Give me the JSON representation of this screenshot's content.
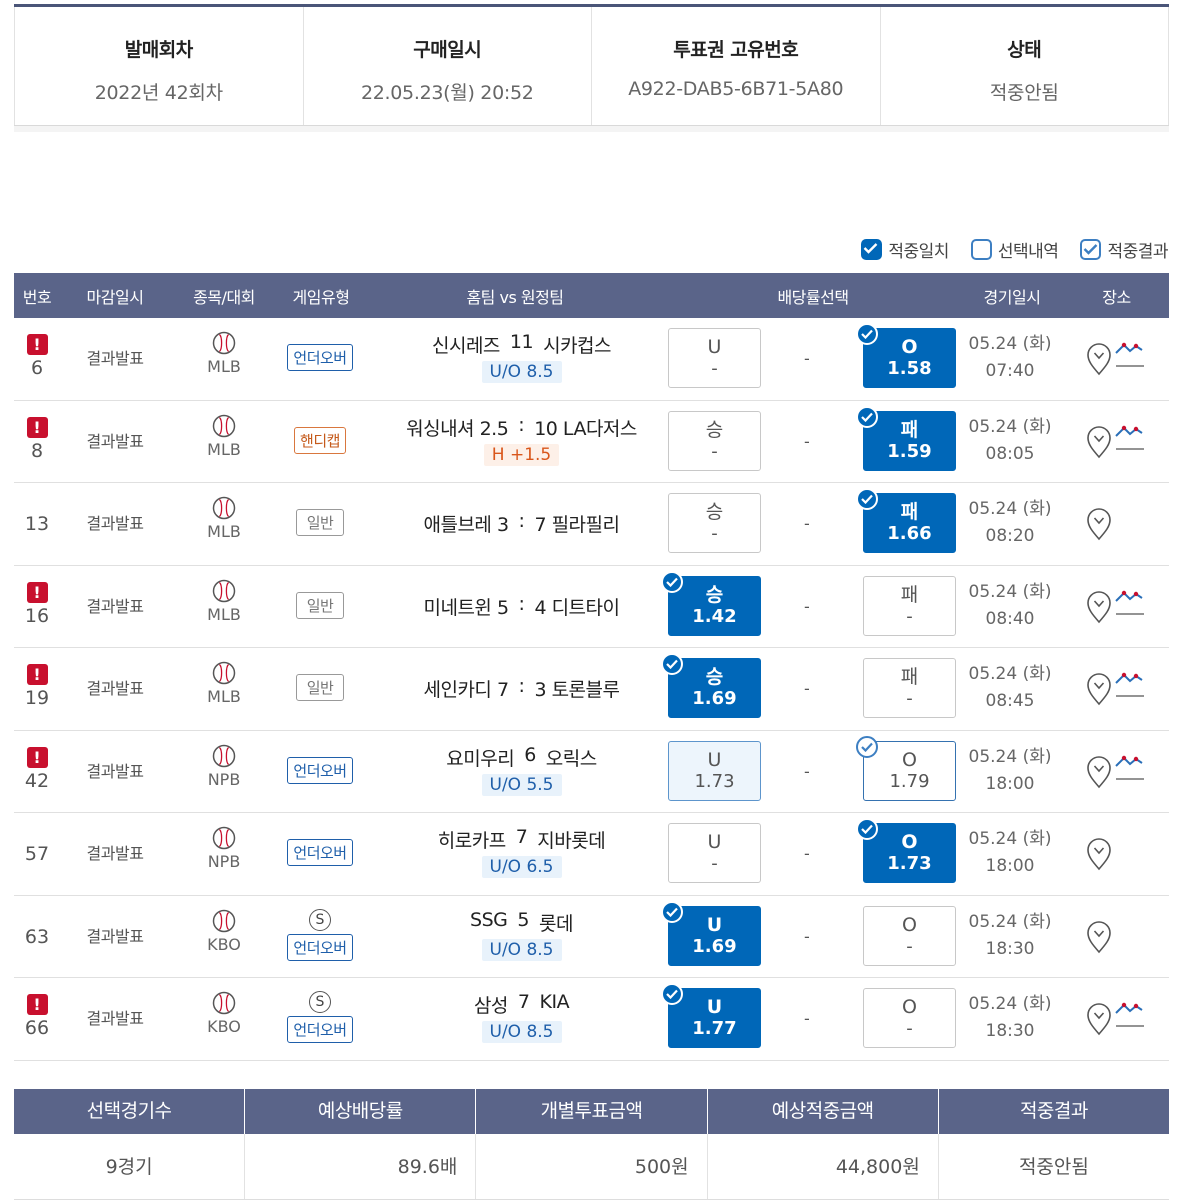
{
  "summary": {
    "round_label": "발매회차",
    "round_value": "2022년 42회차",
    "purchase_label": "구매일시",
    "purchase_value": "22.05.23(월) 20:52",
    "ticket_label": "투표권 고유번호",
    "ticket_value": "A922-DAB5-6B71-5A80",
    "status_label": "상태",
    "status_value": "적중안됨"
  },
  "legend": {
    "hit_match": "적중일치",
    "selection": "선택내역",
    "hit_result": "적중결과"
  },
  "table_headers": {
    "no": "번호",
    "close": "마감일시",
    "sport": "종목/대회",
    "type": "게임유형",
    "teams": "홈팀 vs 원정팀",
    "odds": "배당률선택",
    "date": "경기일시",
    "venue": "장소"
  },
  "rows": [
    {
      "no": "6",
      "warn": "!",
      "close": "결과발표",
      "league": "MLB",
      "type": "언더오버",
      "home": "신시레즈",
      "score": "11",
      "away": "시카컵스",
      "sub": "U/O 8.5",
      "o1_label": "U",
      "o1_val": "-",
      "mid": "-",
      "o3_label": "O",
      "o3_val": "1.58",
      "date": "05.24 (화)",
      "time": "07:40"
    },
    {
      "no": "8",
      "warn": "!",
      "close": "결과발표",
      "league": "MLB",
      "type": "핸디캡",
      "home": "워싱내셔 2.5",
      "score": ":",
      "away": "10 LA다저스",
      "sub": "H +1.5",
      "o1_label": "승",
      "o1_val": "-",
      "mid": "-",
      "o3_label": "패",
      "o3_val": "1.59",
      "date": "05.24 (화)",
      "time": "08:05"
    },
    {
      "no": "13",
      "close": "결과발표",
      "league": "MLB",
      "type": "일반",
      "home": "애틀브레 3",
      "score": ":",
      "away": "7 필라필리",
      "o1_label": "승",
      "o1_val": "-",
      "mid": "-",
      "o3_label": "패",
      "o3_val": "1.66",
      "date": "05.24 (화)",
      "time": "08:20"
    },
    {
      "no": "16",
      "warn": "!",
      "close": "결과발표",
      "league": "MLB",
      "type": "일반",
      "home": "미네트윈 5",
      "score": ":",
      "away": "4 디트타이",
      "o1_label": "승",
      "o1_val": "1.42",
      "mid": "-",
      "o3_label": "패",
      "o3_val": "-",
      "date": "05.24 (화)",
      "time": "08:40"
    },
    {
      "no": "19",
      "warn": "!",
      "close": "결과발표",
      "league": "MLB",
      "type": "일반",
      "home": "세인카디 7",
      "score": ":",
      "away": "3 토론블루",
      "o1_label": "승",
      "o1_val": "1.69",
      "mid": "-",
      "o3_label": "패",
      "o3_val": "-",
      "date": "05.24 (화)",
      "time": "08:45"
    },
    {
      "no": "42",
      "warn": "!",
      "close": "결과발표",
      "league": "NPB",
      "type": "언더오버",
      "home": "요미우리",
      "score": "6",
      "away": "오릭스",
      "sub": "U/O 5.5",
      "o1_label": "U",
      "o1_val": "1.73",
      "mid": "-",
      "o3_label": "O",
      "o3_val": "1.79",
      "date": "05.24 (화)",
      "time": "18:00"
    },
    {
      "no": "57",
      "close": "결과발표",
      "league": "NPB",
      "type": "언더오버",
      "home": "히로카프",
      "score": "7",
      "away": "지바롯데",
      "sub": "U/O 6.5",
      "o1_label": "U",
      "o1_val": "-",
      "mid": "-",
      "o3_label": "O",
      "o3_val": "1.73",
      "date": "05.24 (화)",
      "time": "18:00"
    },
    {
      "no": "63",
      "close": "결과발표",
      "league": "KBO",
      "s_mark": "S",
      "type": "언더오버",
      "home": "SSG",
      "score": "5",
      "away": "롯데",
      "sub": "U/O 8.5",
      "o1_label": "U",
      "o1_val": "1.69",
      "mid": "-",
      "o3_label": "O",
      "o3_val": "-",
      "date": "05.24 (화)",
      "time": "18:30"
    },
    {
      "no": "66",
      "warn": "!",
      "close": "결과발표",
      "league": "KBO",
      "s_mark": "S",
      "type": "언더오버",
      "home": "삼성",
      "score": "7",
      "away": "KIA",
      "sub": "U/O 8.5",
      "o1_label": "U",
      "o1_val": "1.77",
      "mid": "-",
      "o3_label": "O",
      "o3_val": "-",
      "date": "05.24 (화)",
      "time": "18:30"
    }
  ],
  "bottom": {
    "headers": [
      "선택경기수",
      "예상배당률",
      "개별투표금액",
      "예상적중금액",
      "적중결과"
    ],
    "values": [
      "9경기",
      "89.6배",
      "500원",
      "44,800원",
      "적중안됨"
    ]
  },
  "colors": {
    "header_bg": "#5a6489",
    "selected": "#0067b8",
    "warn": "#c8102e"
  }
}
